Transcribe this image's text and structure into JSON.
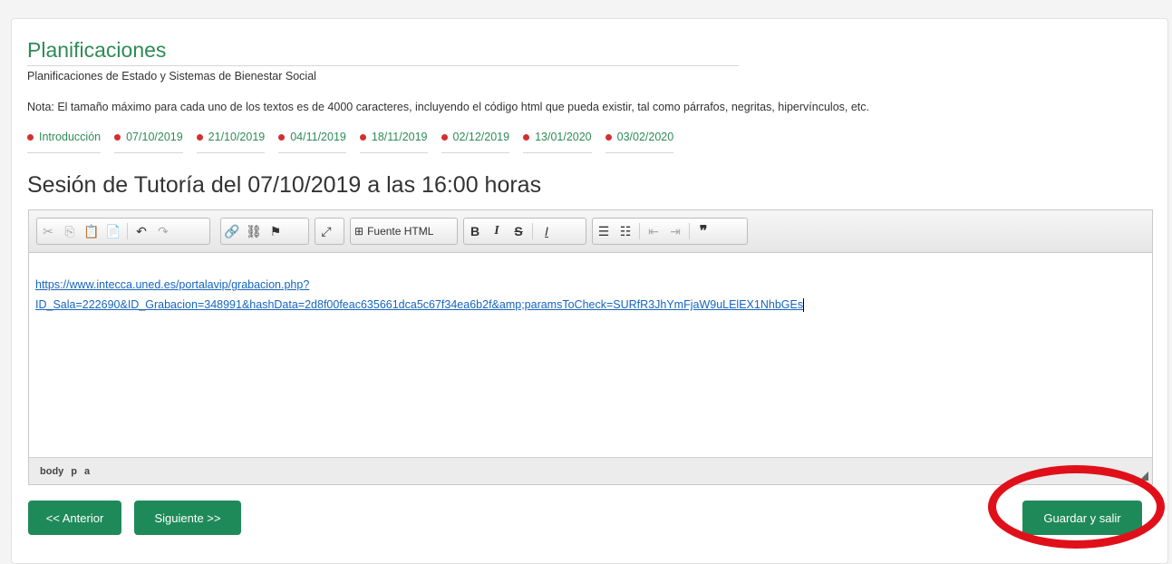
{
  "header": {
    "title": "Planificaciones",
    "subtitle": "Planificaciones de Estado y Sistemas de Bienestar Social",
    "note": "Nota: El tamaño máximo para cada uno de los textos es de 4000 caracteres, incluyendo el código html que pueda existir, tal como párrafos, negritas, hipervínculos, etc."
  },
  "dates": [
    "Introducción",
    "07/10/2019",
    "21/10/2019",
    "04/11/2019",
    "18/11/2019",
    "02/12/2019",
    "13/01/2020",
    "03/02/2020"
  ],
  "session": {
    "title": "Sesión de Tutoría del 07/10/2019 a las 16:00 horas"
  },
  "editor": {
    "source_label": "Fuente HTML",
    "link_line1": "https://www.intecca.uned.es/portalavip/grabacion.php?",
    "link_line2": "ID_Sala=222690&ID_Grabacion=348991&hashData=2d8f00feac635661dca5c67f34ea6b2f&amp;paramsToCheck=SURfR3JhYmFjaW9uLElEX1NhbGEs",
    "path": [
      "body",
      "p",
      "a"
    ]
  },
  "buttons": {
    "prev": "<< Anterior",
    "next": "Siguiente >>",
    "save": "Guardar y salir"
  },
  "colors": {
    "accent": "#1f8a59",
    "dot": "#d32f2f",
    "highlight": "#e0101a"
  }
}
